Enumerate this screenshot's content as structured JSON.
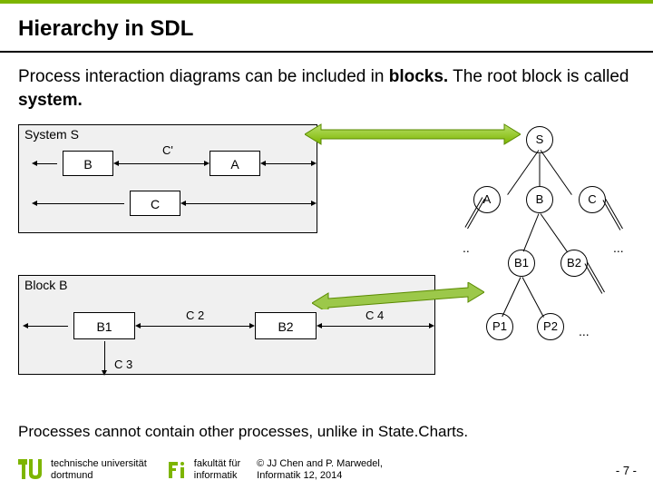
{
  "title": "Hierarchy in SDL",
  "intro": {
    "text1": "Process interaction diagrams can be included in ",
    "bold1": "blocks.",
    "text2": " The root block is called ",
    "bold2": "system."
  },
  "system": {
    "label": "System S",
    "blocks": {
      "B": "B",
      "A": "A",
      "C": "C"
    },
    "channel": "C'"
  },
  "blockB": {
    "label": "Block B",
    "blocks": {
      "B1": "B1",
      "B2": "B2"
    },
    "channels": {
      "C2": "C 2",
      "C3": "C 3",
      "C4": "C 4"
    }
  },
  "tree": {
    "S": "S",
    "A": "A",
    "B": "B",
    "C": "C",
    "B1": "B1",
    "B2": "B2",
    "P1": "P1",
    "P2": "P2",
    "dots": "...",
    "dots2": "..",
    "dots3": "..."
  },
  "bottom": "Processes cannot contain other processes, unlike in State.Charts.",
  "footer": {
    "uni1": "technische universität",
    "uni2": "dortmund",
    "fac1": "fakultät für",
    "fac2": "informatik",
    "credit1": "© JJ Chen and  P. Marwedel,",
    "credit2": "Informatik 12,  2014",
    "page": "-  7 -"
  }
}
